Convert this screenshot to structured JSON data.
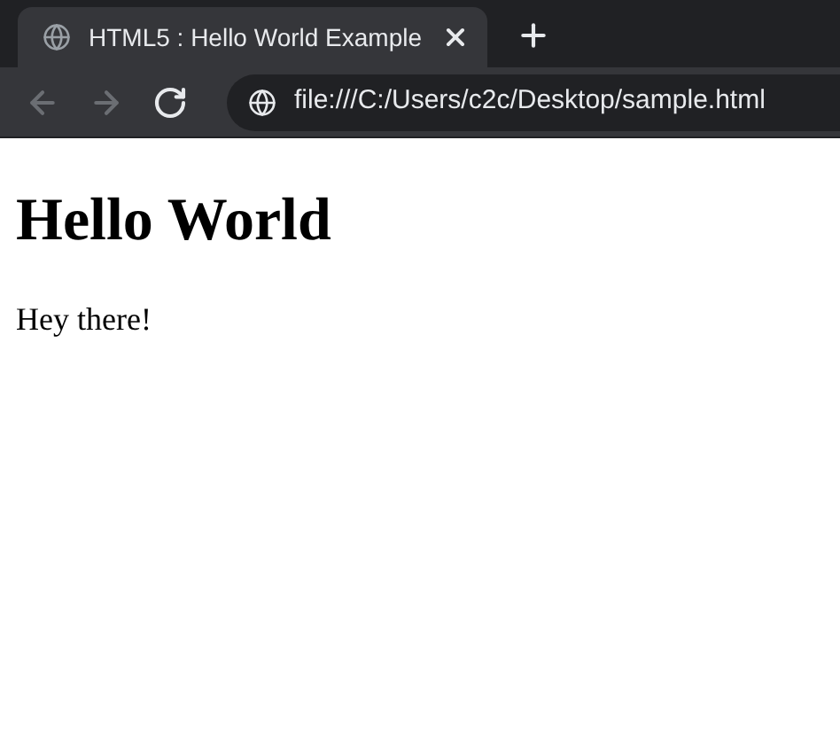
{
  "tab": {
    "title": "HTML5 : Hello World Example",
    "selected": true
  },
  "nav": [
    {
      "kind": "back",
      "disabled": true
    },
    {
      "kind": "forward",
      "disabled": true
    },
    {
      "kind": "reload",
      "disabled": false
    }
  ],
  "address_bar": {
    "value": "file:///C:/Users/c2c/Desktop/sample.html"
  },
  "page": {
    "heading": "Hello World",
    "paragraph": "Hey there!"
  }
}
